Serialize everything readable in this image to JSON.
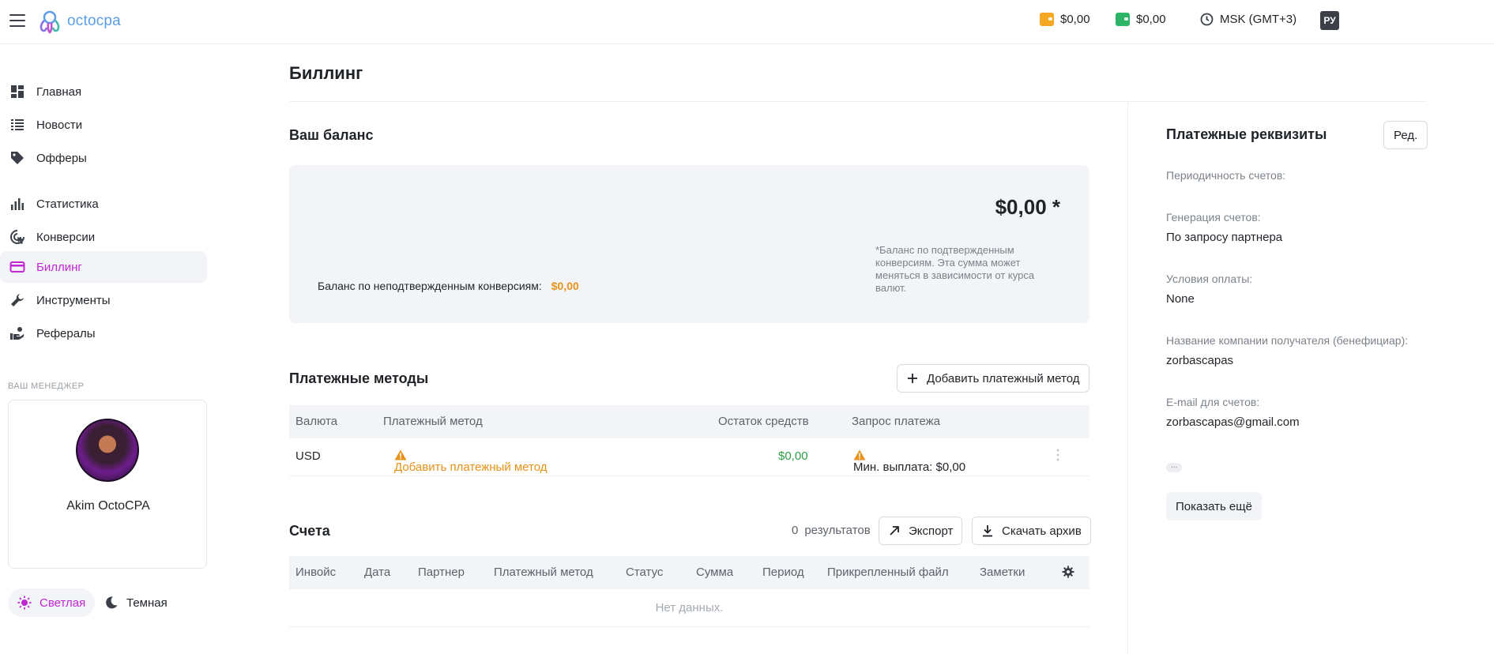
{
  "colors": {
    "accent": "#c026d3",
    "warning": "#e8921a",
    "success": "#2e9e48",
    "wallet_orange": "#f5a623",
    "wallet_green": "#2cb567"
  },
  "header": {
    "logo": "octocpa",
    "wallet_1": "$0,00",
    "wallet_2": "$0,00",
    "timezone": "MSK (GMT+3)",
    "language": "РУ"
  },
  "sidebar": {
    "items": [
      {
        "label": "Главная",
        "icon": "dashboard-icon"
      },
      {
        "label": "Новости",
        "icon": "news-list-icon"
      },
      {
        "label": "Офферы",
        "icon": "tag-icon"
      },
      {
        "label": "Статистика",
        "icon": "bar-chart-icon"
      },
      {
        "label": "Конверсии",
        "icon": "target-cursor-icon"
      },
      {
        "label": "Биллинг",
        "icon": "credit-card-icon",
        "active": true
      },
      {
        "label": "Инструменты",
        "icon": "wrench-icon"
      },
      {
        "label": "Рефералы",
        "icon": "referral-hand-icon"
      }
    ],
    "manager_title": "ВАШ МЕНЕДЖЕР",
    "manager_name": "Akim OctoCPA",
    "theme_light": "Светлая",
    "theme_dark": "Темная"
  },
  "main": {
    "title": "Биллинг",
    "balance": {
      "title": "Ваш баланс",
      "amount": "$0,00 *",
      "note": "*Баланс по подтвержденным конверсиям. Эта сумма может меняться в зависимости от курса валют.",
      "unconfirmed_label": "Баланс по неподтвержденным конверсиям:",
      "unconfirmed_value": "$0,00"
    },
    "payment_methods": {
      "title": "Платежные методы",
      "add_button": "Добавить платежный метод",
      "columns": [
        "Валюта",
        "Платежный метод",
        "Остаток средств",
        "Запрос платежа"
      ],
      "rows": [
        {
          "currency": "USD",
          "method": "Добавить платежный метод",
          "balance": "$0,00",
          "request": "Мин. выплата: $0,00"
        }
      ]
    },
    "invoices": {
      "title": "Счета",
      "results_count": "0",
      "results_label": "результатов",
      "export_button": "Экспорт",
      "download_button": "Скачать архив",
      "columns": [
        "Инвойс",
        "Дата",
        "Партнер",
        "Платежный метод",
        "Статус",
        "Сумма",
        "Период",
        "Прикрепленный файл",
        "Заметки"
      ],
      "empty": "Нет данных."
    }
  },
  "details": {
    "title": "Платежные реквизиты",
    "edit_button": "Ред.",
    "fields": [
      {
        "label": "Периодичность счетов:",
        "value": ""
      },
      {
        "label": "Генерация счетов:",
        "value": "По запросу партнера"
      },
      {
        "label": "Условия оплаты:",
        "value": "None"
      },
      {
        "label": "Название компании получателя (бенефициар):",
        "value": "zorbascapas"
      },
      {
        "label": "E-mail для счетов:",
        "value": "zorbascapas@gmail.com"
      }
    ],
    "ellipsis": "...",
    "show_more": "Показать ещё"
  }
}
